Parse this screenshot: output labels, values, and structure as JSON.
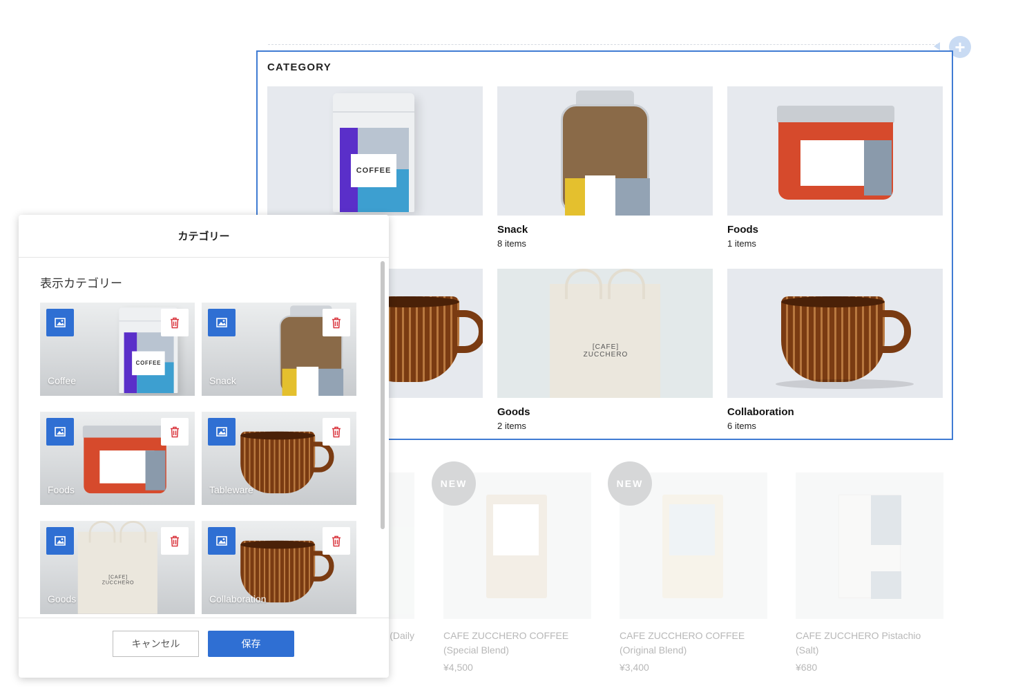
{
  "category_section": {
    "heading": "CATEGORY",
    "cards": [
      {
        "name": "",
        "count": ""
      },
      {
        "name": "Snack",
        "count": "8 items"
      },
      {
        "name": "Foods",
        "count": "1 items"
      },
      {
        "name": "",
        "count": ""
      },
      {
        "name": "Goods",
        "count": "2 items"
      },
      {
        "name": "Collaboration",
        "count": "6 items"
      }
    ],
    "product_labels": {
      "coffee_bag": "COFFEE",
      "tote_logo_line1": "[CAFE]",
      "tote_logo_line2": "ZUCCHERO"
    }
  },
  "products": [
    {
      "name": "(Daily",
      "price": "",
      "badge": ""
    },
    {
      "name": "CAFE ZUCCHERO COFFEE (Special Blend)",
      "price": "¥4,500",
      "badge": "NEW"
    },
    {
      "name": "CAFE ZUCCHERO COFFEE (Original Blend)",
      "price": "¥3,400",
      "badge": "NEW"
    },
    {
      "name": "CAFE ZUCCHERO Pistachio (Salt)",
      "price": "¥680",
      "badge": ""
    }
  ],
  "modal": {
    "title": "カテゴリー",
    "section_label": "表示カテゴリー",
    "tiles": [
      {
        "name": "Coffee"
      },
      {
        "name": "Snack"
      },
      {
        "name": "Foods"
      },
      {
        "name": "Tableware"
      },
      {
        "name": "Goods"
      },
      {
        "name": "Collaboration"
      }
    ],
    "cancel_label": "キャンセル",
    "save_label": "保存"
  },
  "colors": {
    "accent": "#2f6fd3",
    "selection_border": "#3f7bd3",
    "delete_icon": "#d9363e"
  },
  "icons": {
    "add": "plus-circle-icon",
    "image": "image-icon",
    "delete": "trash-icon"
  }
}
